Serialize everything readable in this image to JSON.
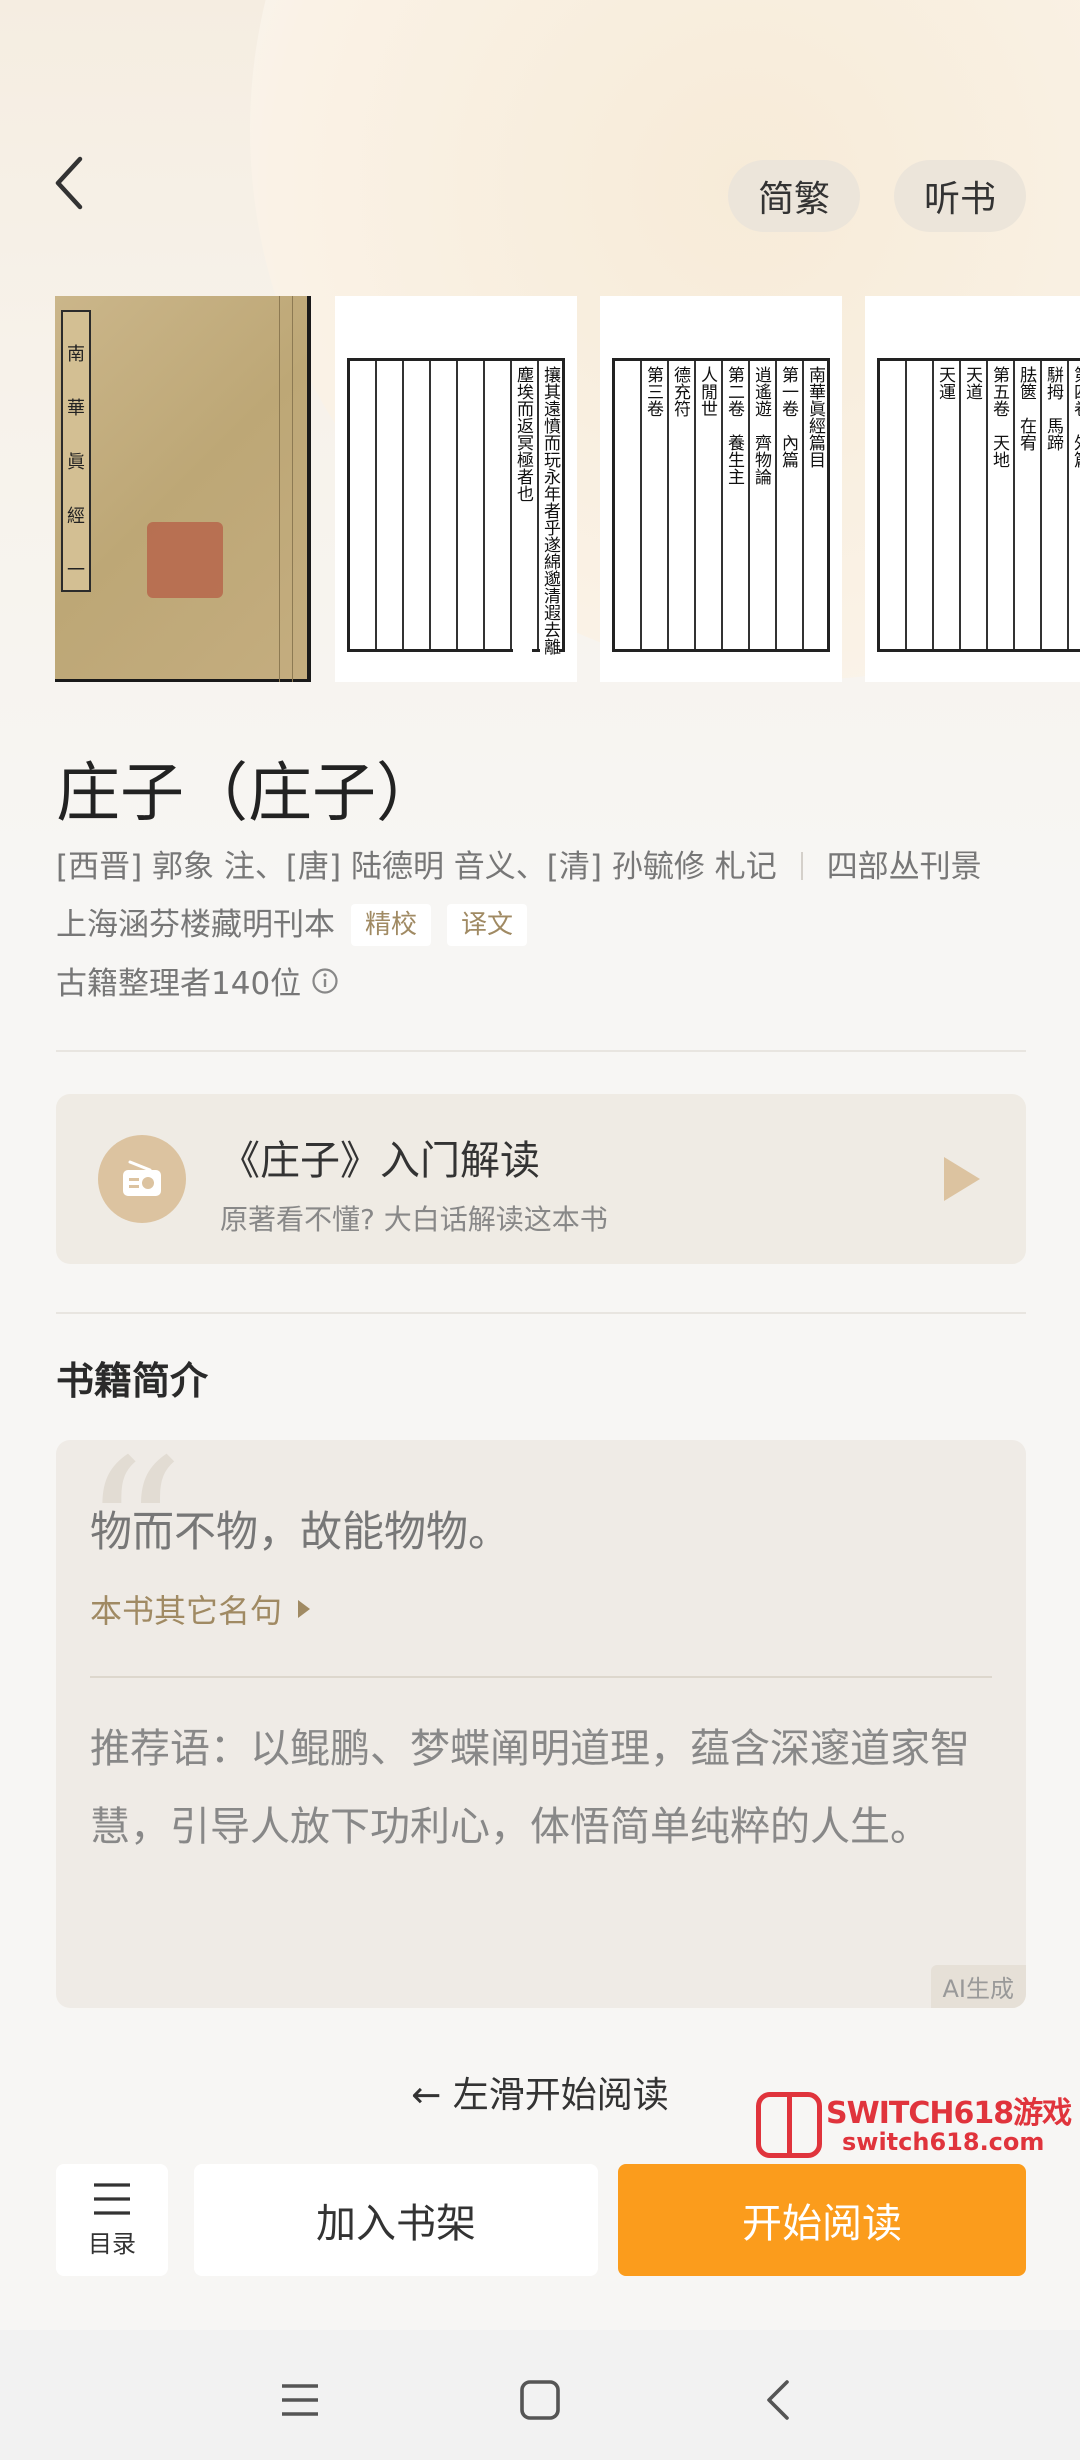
{
  "header": {
    "simplified_traditional": "简繁",
    "listen": "听书"
  },
  "cover": {
    "label_chars": [
      "南",
      "華",
      "眞",
      "經",
      "一"
    ]
  },
  "pages": [
    {
      "cols": [
        "攘其遠憤而玩永年者乎遂綿邈清遐去離",
        "塵埃而返冥極者也"
      ]
    },
    {
      "cols": [
        "南華眞經篇目",
        "第一卷　內篇",
        "逍遙遊　齊物論",
        "第二卷　養生主",
        "人閒世",
        "德充符",
        "第三卷"
      ]
    },
    {
      "cols": [
        "第四卷　外篇",
        "駢拇　馬蹄",
        "胠篋　在宥",
        "第五卷　天地",
        "天道",
        "天運"
      ]
    }
  ],
  "book": {
    "title": "庄子（庄子）",
    "authors": "[西晋] 郭象 注、[唐] 陆德明 音义、[清] 孙毓修 札记",
    "edition_line1": "四部丛刊景",
    "edition_line2": "上海涵芬楼藏明刊本",
    "tag_proofread": "精校",
    "tag_translation": "译文",
    "editors": "古籍整理者140位"
  },
  "intro": {
    "title": "《庄子》入门解读",
    "subtitle": "原著看不懂? 大白话解读这本书"
  },
  "synopsis": {
    "heading": "书籍简介",
    "quote": "物而不物，故能物物。",
    "more_quotes": "本书其它名句",
    "recommendation": "推荐语：以鲲鹏、梦蝶阐明道理，蕴含深邃道家智慧，引导人放下功利心，体悟简单纯粹的人生。",
    "ai_badge": "AI生成"
  },
  "swipe_hint": "← 左滑开始阅读",
  "watermark": {
    "brand": "SWITCH618游戏",
    "url": "switch618.com"
  },
  "actions": {
    "toc": "目录",
    "add_shelf": "加入书架",
    "start_reading": "开始阅读"
  },
  "colors": {
    "accent": "#fb9c1c",
    "tag_text": "#a08a63",
    "watermark": "#e0343c"
  }
}
